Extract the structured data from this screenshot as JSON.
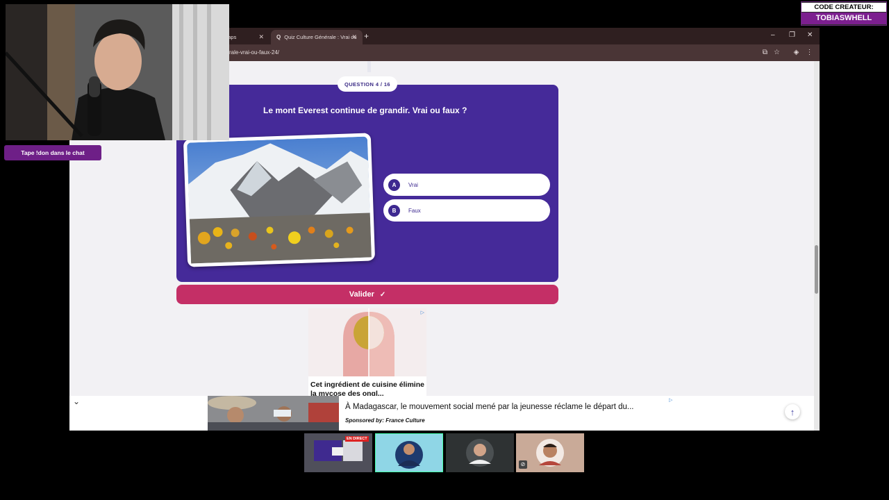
{
  "browser": {
    "tabs": [
      {
        "label": "Maps"
      },
      {
        "label": "Quiz Culture Générale : Vrai ou"
      }
    ],
    "url": "rale-vrai-ou-faux-24/"
  },
  "quiz": {
    "badge": "QUESTION 4 / 16",
    "question": "Le mont Everest continue de grandir. Vrai ou faux ?",
    "answers": [
      {
        "letter": "A",
        "label": "Vrai"
      },
      {
        "letter": "B",
        "label": "Faux"
      }
    ],
    "validate_label": "Valider"
  },
  "ad_side": {
    "text": "Cet ingrédient de cuisine élimine la mycose des ongl..."
  },
  "bottom_ad": {
    "title": "À Madagascar, le mouvement social mené par la jeunesse réclame le départ du...",
    "sponsor": "Sponsored by: France Culture"
  },
  "stream": {
    "chat_prompt": "Tape !don dans le chat",
    "creator_code_label": "CODE CREATEUR:",
    "creator_code": "TOBIASWHELL",
    "live_badge": "EN DIRECT"
  },
  "colors": {
    "card": "#452a99",
    "validate": "#c42f66",
    "accent_purple": "#7c1f8f"
  }
}
